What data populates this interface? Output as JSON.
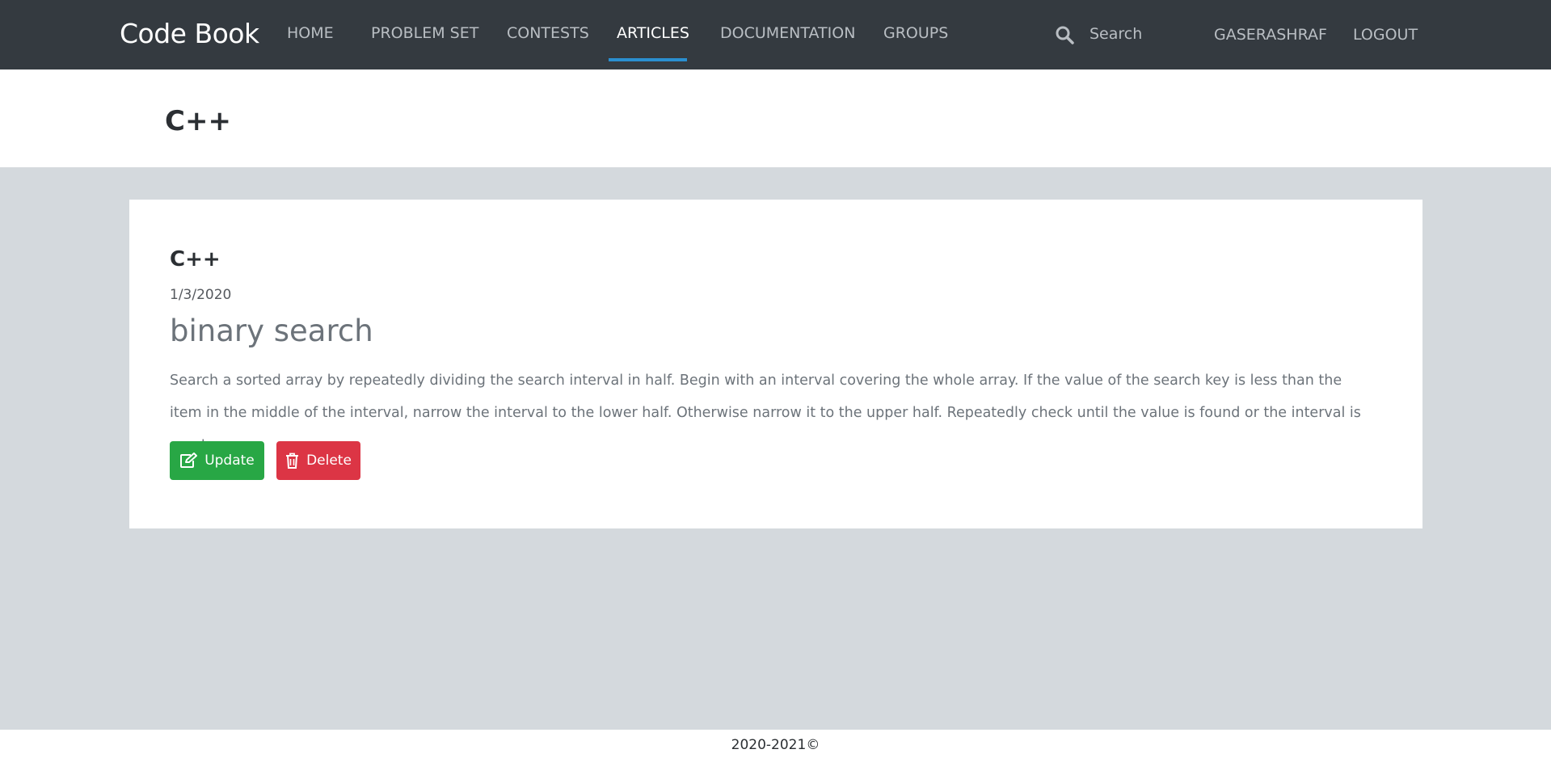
{
  "navbar": {
    "brand": "Code Book",
    "items": [
      {
        "label": "HOME"
      },
      {
        "label": "PROBLEM SET"
      },
      {
        "label": "CONTESTS"
      },
      {
        "label": "ARTICLES"
      },
      {
        "label": "DOCUMENTATION"
      },
      {
        "label": "GROUPS"
      }
    ],
    "active_item": "ARTICLES",
    "search": {
      "placeholder": "Search",
      "icon": "search-icon"
    },
    "user": "GASERASHRAF",
    "logout": "LOGOUT"
  },
  "header": {
    "title": "C++"
  },
  "article": {
    "category": "C++",
    "date": "1/3/2020",
    "title": "binary search",
    "body": "Search a sorted array by repeatedly dividing the search interval in half. Begin with an interval covering the whole array. If the value of the search key is less than the item in the middle of the interval, narrow the interval to the lower half. Otherwise narrow it to the upper half. Repeatedly check until the value is found or the interval is empty.",
    "update_label": "Update",
    "delete_label": "Delete",
    "update_icon": "edit-icon",
    "delete_icon": "trash-icon"
  },
  "footer": {
    "text": "2020-2021©"
  },
  "colors": {
    "navbar_bg": "#343a40",
    "active_underline": "#2a8fd0",
    "update_button": "#28a745",
    "delete_button": "#dc3545",
    "page_bg": "#d4d9dd"
  }
}
